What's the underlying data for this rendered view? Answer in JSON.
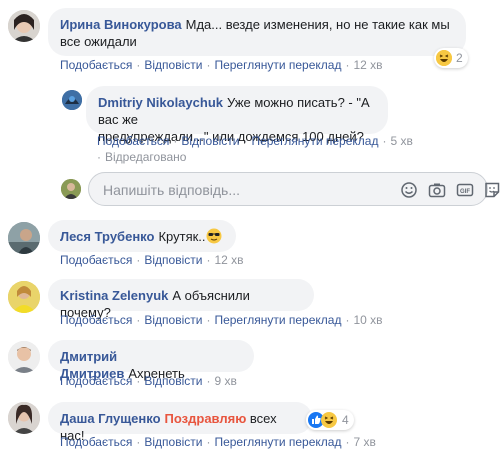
{
  "actions": {
    "like": "Подобається",
    "reply": "Відповісти",
    "translate": "Переглянути переклад"
  },
  "comments": [
    {
      "author": "Ирина Винокурова",
      "text_line1": "Мда... везде изменения, но не такие как мы",
      "text_line2": "все ожидали",
      "reactions": "2",
      "time": "12 хв"
    },
    {
      "author": "Dmitriy Nikolaychuk",
      "text_line1": "Уже можно писать? - \"А вас же",
      "text_line2": "предупреждали...\" или дождемся 100 дней?",
      "time": "5 хв",
      "edited": "Відредаговано"
    },
    {
      "author": "Леся Трубенко",
      "text": "Крутяк..",
      "time": "12 хв"
    },
    {
      "author": "Kristina Zelenyuk",
      "text": "А объяснили почему?",
      "time": "10 хв"
    },
    {
      "author": "Дмитрий Дмитриев",
      "text": "Ахренеть",
      "time": "9 хв"
    },
    {
      "author": "Даша Глущенко",
      "text_highlight": "Поздравляю",
      "text": " всех нас!",
      "reactions": "4",
      "time": "7 хв"
    }
  ],
  "reply_box": {
    "placeholder": "Напишіть відповідь..."
  },
  "colors": {
    "link": "#385898",
    "bubble": "#f2f3f5",
    "meta": "#90949c",
    "highlight": "#e8553e"
  }
}
